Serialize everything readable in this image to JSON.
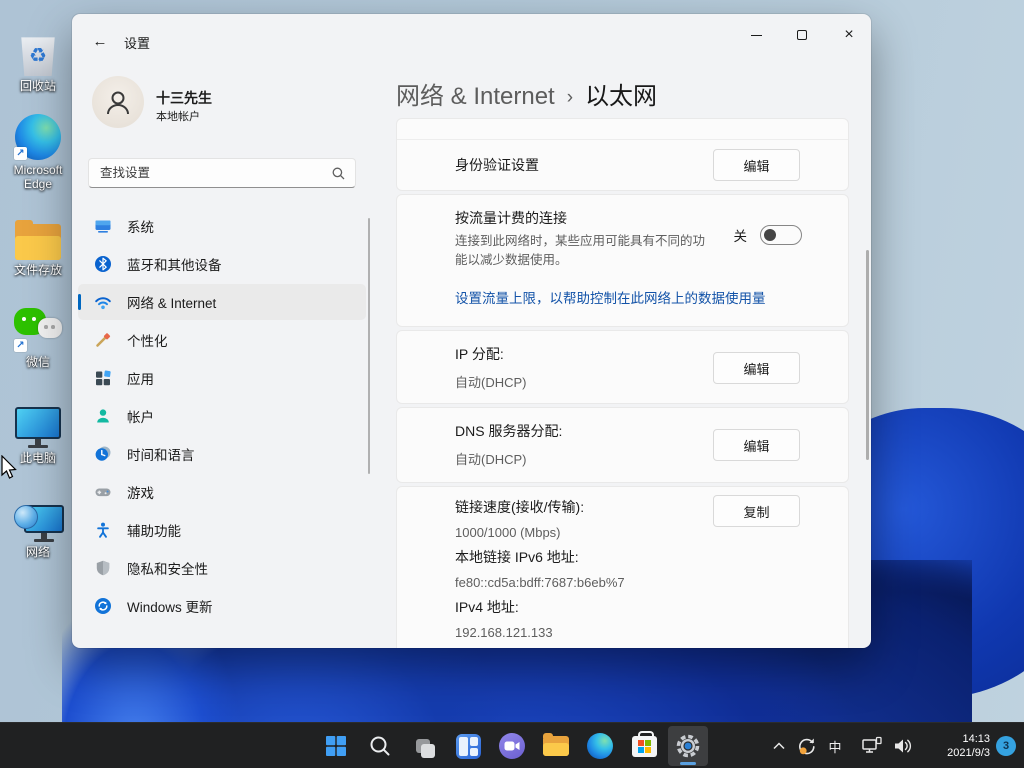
{
  "desktop": {
    "icons": [
      "回收站",
      "Microsoft Edge",
      "文件存放",
      "微信",
      "此电脑",
      "网络"
    ]
  },
  "win": {
    "title": "设置",
    "profile_name": "十三先生",
    "profile_type": "本地帐户",
    "search_placeholder": "查找设置",
    "nav": [
      "系统",
      "蓝牙和其他设备",
      "网络 & Internet",
      "个性化",
      "应用",
      "帐户",
      "时间和语言",
      "游戏",
      "辅助功能",
      "隐私和安全性",
      "Windows 更新"
    ],
    "breadcrumb_root": "网络 & Internet",
    "breadcrumb_sep": "›",
    "breadcrumb_current": "以太网",
    "auth_label": "身份验证设置",
    "auth_button": "编辑",
    "metered_title": "按流量计费的连接",
    "metered_desc": "连接到此网络时，某些应用可能具有不同的功能以减少数据使用。",
    "metered_toggle_state": "关",
    "metered_link": "设置流量上限，以帮助控制在此网络上的数据使用量",
    "ip_label": "IP 分配:",
    "ip_value": "自动(DHCP)",
    "ip_button": "编辑",
    "dns_label": "DNS 服务器分配:",
    "dns_value": "自动(DHCP)",
    "dns_button": "编辑",
    "speed_label": "链接速度(接收/传输):",
    "speed_value": "1000/1000 (Mbps)",
    "speed_button": "复制",
    "ipv6_label": "本地链接 IPv6 地址:",
    "ipv6_value": "fe80::cd5a:bdff:7687:b6eb%7",
    "ipv4_label": "IPv4 地址:",
    "ipv4_value": "192.168.121.133"
  },
  "taskbar": {
    "ime": "中",
    "time": "14:13",
    "date": "2021/9/3",
    "badge": "3"
  },
  "colors": {
    "accent": "#0067c0",
    "link": "#1353a8",
    "badge": "#35a2e0",
    "taskbar": "#202122",
    "selected_nav": "#eaeaea"
  }
}
